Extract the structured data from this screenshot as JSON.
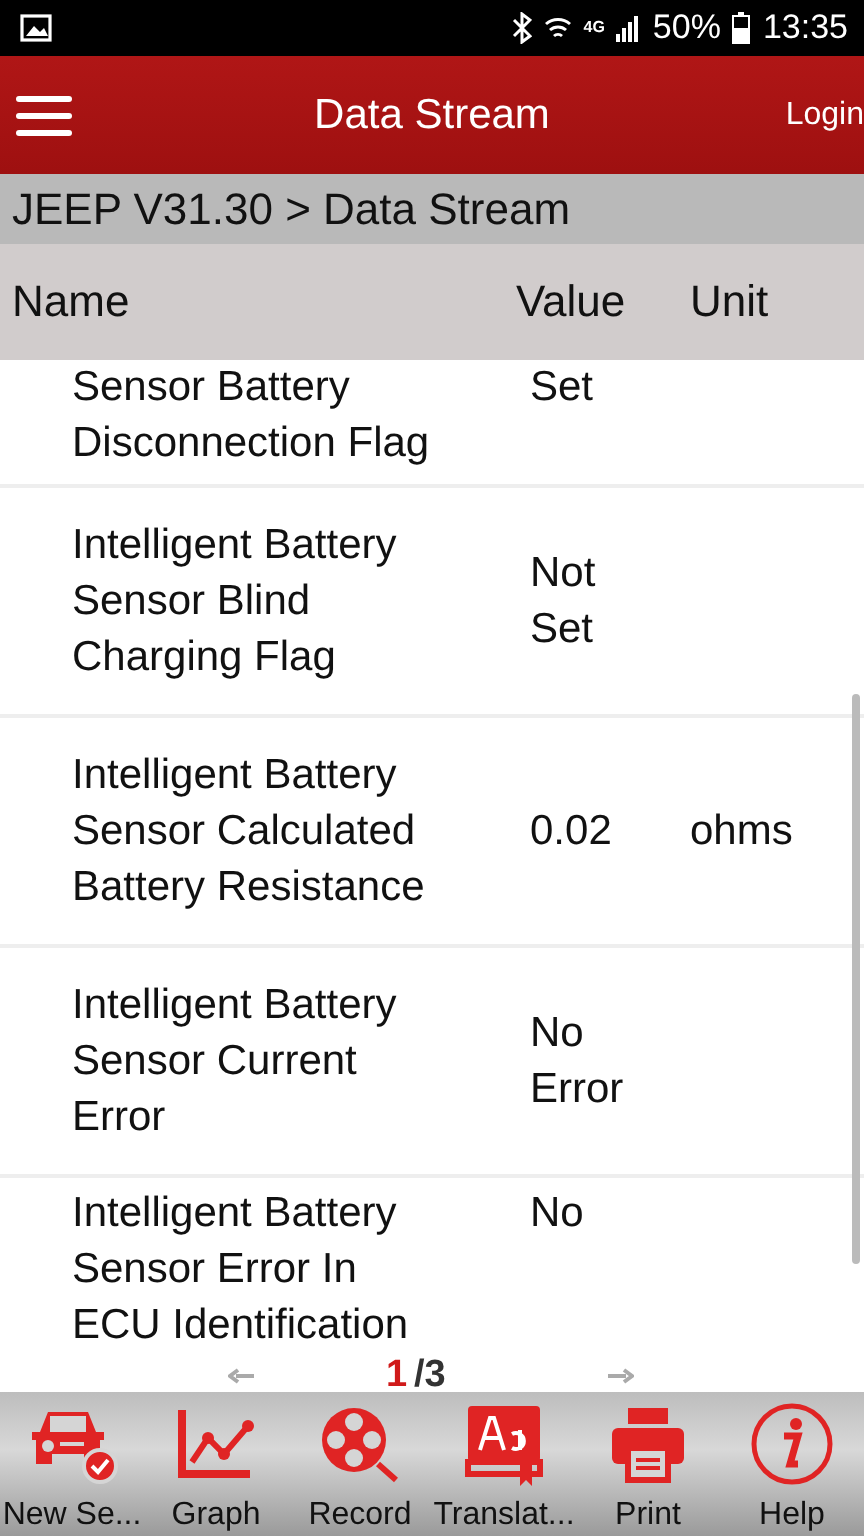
{
  "status_bar": {
    "network": "4G",
    "battery": "50%",
    "time": "13:35"
  },
  "header": {
    "title": "Data Stream",
    "login": "Login"
  },
  "breadcrumb": "JEEP V31.30 > Data Stream",
  "table": {
    "columns": [
      "Name",
      "Value",
      "Unit"
    ],
    "rows": [
      {
        "name": "Sensor Battery\nDisconnection Flag",
        "value": "Set"
      },
      {
        "name": "Intelligent Battery\nSensor Blind\nCharging Flag",
        "value": "Not\nSet"
      },
      {
        "name": "Intelligent Battery\nSensor Calculated\nBattery Resistance",
        "value": "0.02",
        "unit": "ohms"
      },
      {
        "name": "Intelligent Battery\nSensor Current\nError",
        "value": "No\nError"
      },
      {
        "name": "Intelligent Battery\nSensor Error In\nECU Identification",
        "value": "No"
      }
    ]
  },
  "pager": {
    "current": "1",
    "total": "/3"
  },
  "toolbar": [
    {
      "kind": "car",
      "label": "New Se..."
    },
    {
      "kind": "graph",
      "label": "Graph"
    },
    {
      "kind": "record",
      "label": "Record"
    },
    {
      "kind": "translate",
      "label": "Translat..."
    },
    {
      "kind": "print",
      "label": "Print"
    },
    {
      "kind": "help",
      "label": "Help"
    }
  ]
}
